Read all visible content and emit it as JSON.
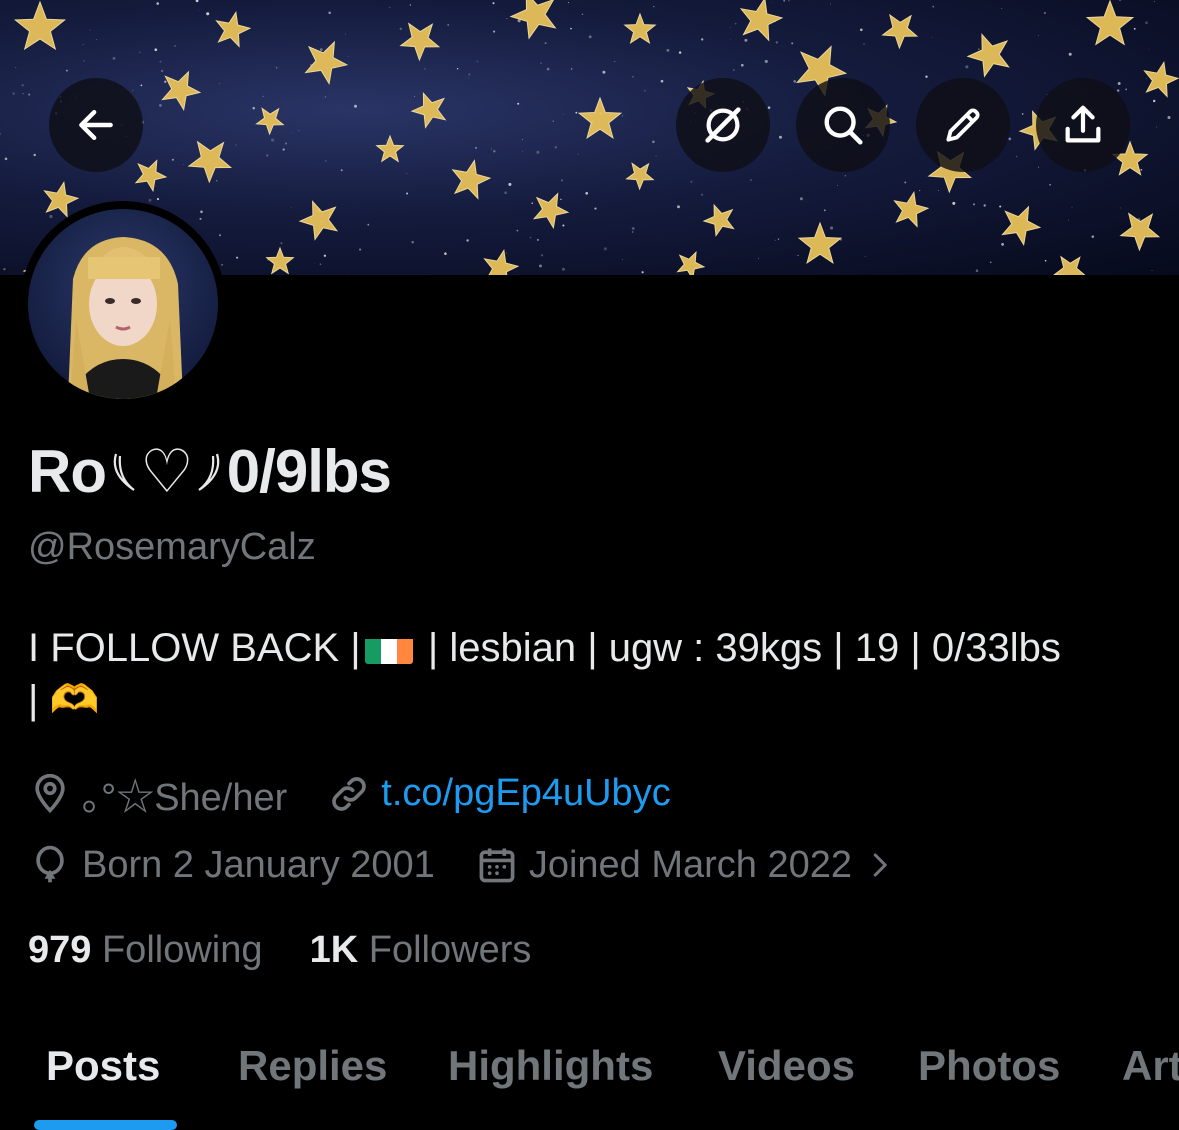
{
  "header": {
    "buttons": [
      "back-arrow-icon",
      "grok-icon",
      "search-icon",
      "edit-icon",
      "share-icon"
    ]
  },
  "profile": {
    "display_name": "Ro",
    "display_name_heart": "♡",
    "display_name_suffix": "0/9lbs",
    "handle": "@RosemaryCalz",
    "bio_part1": "I FOLLOW BACK |",
    "bio_part2": "| lesbian | ugw : 39kgs | 19 | 0/33lbs",
    "bio_line2": "|",
    "bio_emoji": "🫶",
    "location": "｡°☆She/her",
    "link": "t.co/pgEp4uUbyc",
    "birth": "Born 2 January 2001",
    "joined": "Joined March 2022"
  },
  "stats": {
    "following_count": "979",
    "following_label": "Following",
    "followers_count": "1K",
    "followers_label": "Followers"
  },
  "tabs": [
    "Posts",
    "Replies",
    "Highlights",
    "Videos",
    "Photos",
    "Art"
  ],
  "colors": {
    "accent": "#1d9bf0",
    "muted": "#71767b",
    "text": "#e7e9ea",
    "background": "#000000",
    "star": "#e8c15a",
    "flag_green": "#169b62",
    "flag_white": "#ffffff",
    "flag_orange": "#ff883e"
  }
}
